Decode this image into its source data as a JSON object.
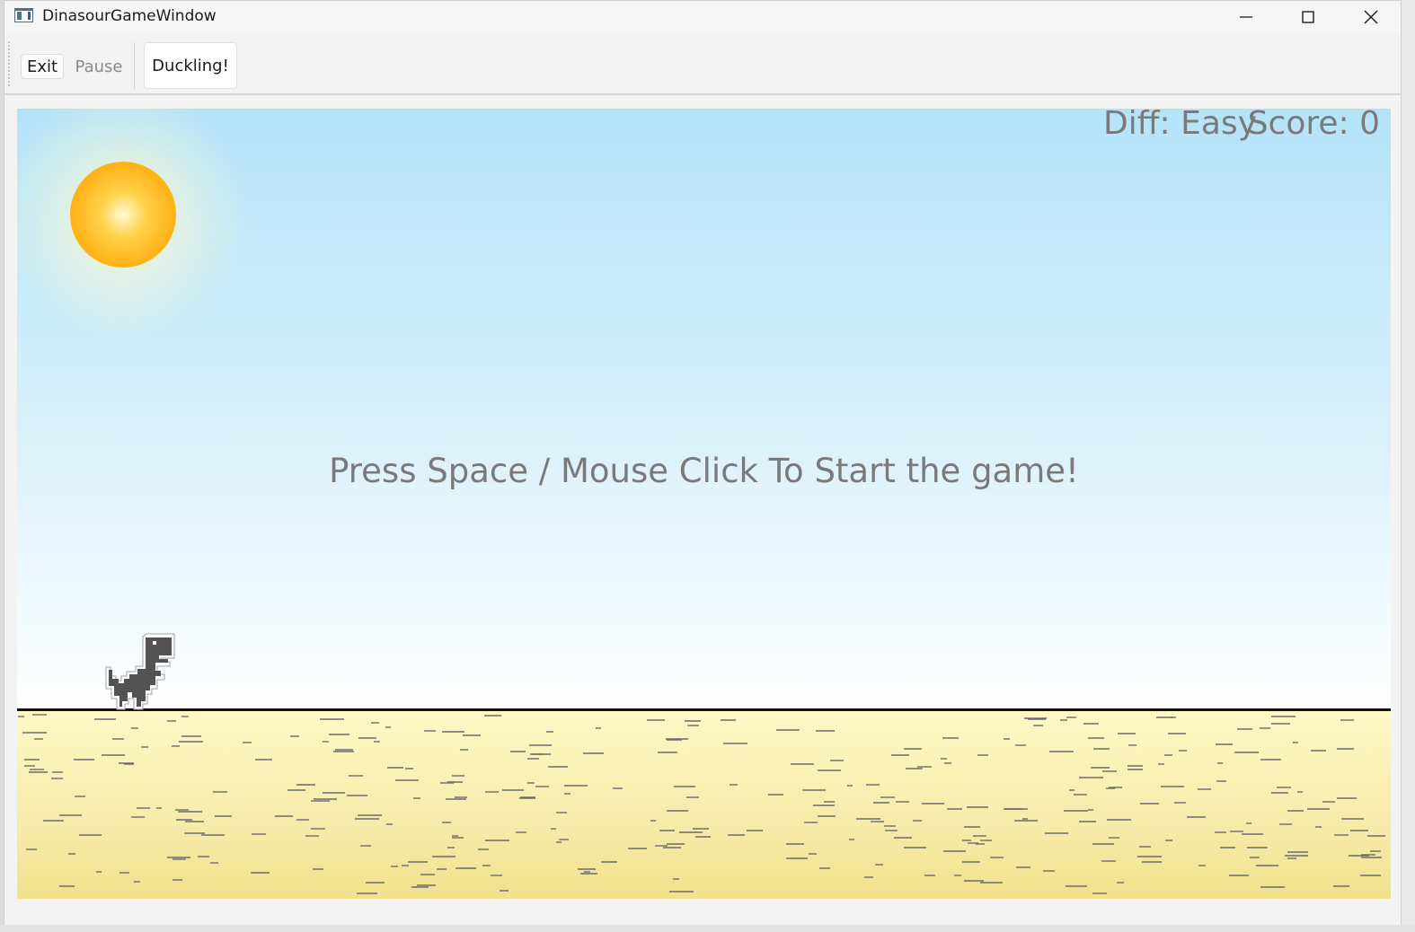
{
  "window": {
    "title": "DinasourGameWindow",
    "icons": {
      "app": "app-window-icon",
      "minimize": "minimize-icon",
      "maximize": "maximize-icon",
      "close": "close-icon"
    }
  },
  "toolbar": {
    "exit_label": "Exit",
    "pause_label": "Pause",
    "duck_label": "Duckling!"
  },
  "game": {
    "difficulty_text": "Diff: Easy",
    "score_text": "Score: 0",
    "start_message": "Press Space / Mouse Click To Start the game!",
    "colors": {
      "sky_top": "#b4e3f8",
      "sky_bottom": "#ffffff",
      "sand": "#f7ebaa",
      "sun": "#ffb51a",
      "hud_text": "#7a7a7a",
      "ground_line": "#111111",
      "dino": "#535353"
    }
  }
}
